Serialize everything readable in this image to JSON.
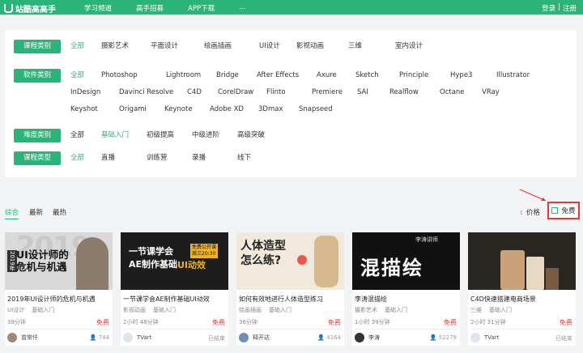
{
  "header": {
    "logo": "站酷高高手",
    "nav": [
      "学习频道",
      "高手招募",
      "APP下载",
      "..."
    ],
    "login": "登录",
    "sep": "|",
    "register": "注册",
    "brand_color": "#2cb37a"
  },
  "filters": [
    {
      "label": "课程类别",
      "options": [
        "全部",
        "摄影艺术",
        "平面设计",
        "绘画插画",
        "UI设计",
        "影视动画",
        "三维",
        "室内设计"
      ],
      "active": 0
    },
    {
      "label": "软件类别",
      "options": [
        "全部",
        "Photoshop",
        "Lightroom",
        "Bridge",
        "After Effects",
        "Axure",
        "Sketch",
        "Principle",
        "Hype3",
        "Illustrator",
        "InDesign",
        "Davinci Resolve",
        "C4D",
        "CorelDraw",
        "Flinto",
        "Premiere",
        "SAI",
        "Realflow",
        "Octane",
        "VRay",
        "Keyshot",
        "Origami",
        "Keynote",
        "Adobe XD",
        "3Dmax",
        "Snapseed"
      ],
      "active": 0
    },
    {
      "label": "难度类别",
      "options": [
        "全部",
        "基础入门",
        "初级提高",
        "中级进阶",
        "高级突破"
      ],
      "active": 1
    },
    {
      "label": "课程类型",
      "options": [
        "全部",
        "直播",
        "训练营",
        "录播",
        "线下"
      ],
      "active": 0
    }
  ],
  "sort": {
    "items": [
      "综合",
      "最新",
      "最热"
    ],
    "active": 0,
    "price_label": "价格",
    "free_label": "免费"
  },
  "courses": [
    {
      "title": "2019年UI设计师的危机与机遇",
      "category": "UI设计",
      "level": "基础入门",
      "duration": "39分钟",
      "price": "免费",
      "author": "曾常仟",
      "stat": "744",
      "stat_icon": "user-icon",
      "thumb_text": "UI设计师的\n危机与机遇",
      "thumb_side": "2019年",
      "thumb_big": "2019"
    },
    {
      "title": "一节课学会AE制作基础UI动效",
      "category": "影视动画",
      "level": "基础入门",
      "duration": "2小时 48分钟",
      "price": "免费",
      "author": "TVart",
      "stat": "已结束",
      "stat_icon": "",
      "thumb_text": "一节课学会\nAE制作基础",
      "thumb_accent": "UI动效",
      "thumb_badge": "免费公开课\n周三20:30"
    },
    {
      "title": "如何有效地进行人体造型练习",
      "category": "绘画插画",
      "level": "基础入门",
      "duration": "36分钟",
      "price": "免费",
      "author": "释开达",
      "stat": "4164",
      "stat_icon": "user-icon",
      "thumb_text": "人体造型\n怎么练?"
    },
    {
      "title": "李涛混描绘",
      "category": "摄影艺术",
      "level": "基础入门",
      "duration": "1小时 39分钟",
      "price": "免费",
      "author": "李涛",
      "stat": "52279",
      "stat_icon": "user-icon",
      "thumb_text": "混描绘",
      "thumb_top": "李涛讲师"
    },
    {
      "title": "C4D快速搭建电商场景",
      "category": "三维",
      "level": "基础入门",
      "duration": "2小时 31分钟",
      "price": "免费",
      "author": "TVart",
      "stat": "已结束",
      "stat_icon": ""
    }
  ]
}
